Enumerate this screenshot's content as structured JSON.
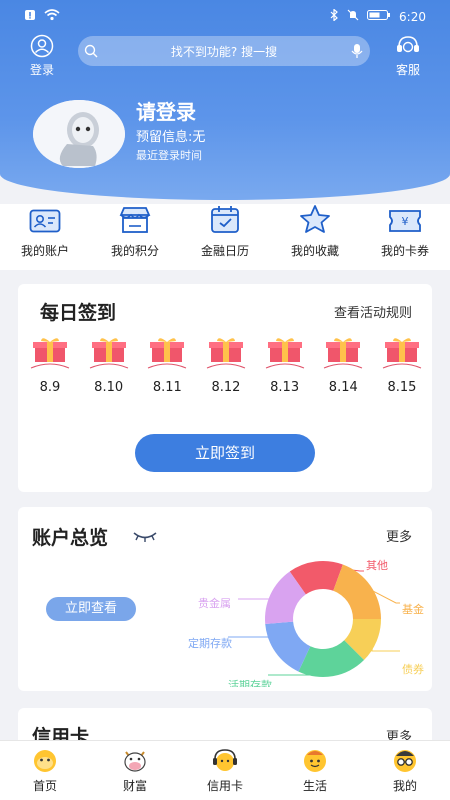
{
  "status_bar": {
    "time": "6:20"
  },
  "header": {
    "login_label": "登录",
    "service_label": "客服",
    "search_placeholder": "找不到功能? 搜一搜",
    "login_title": "请登录",
    "reserved_info": "预留信息:无",
    "last_login": "最近登录时间"
  },
  "quick_menu": [
    {
      "label": "我的账户",
      "icon": "account-card-icon"
    },
    {
      "label": "我的积分",
      "icon": "points-shop-icon"
    },
    {
      "label": "金融日历",
      "icon": "calendar-icon"
    },
    {
      "label": "我的收藏",
      "icon": "star-icon"
    },
    {
      "label": "我的卡券",
      "icon": "coupon-icon"
    }
  ],
  "checkin": {
    "title": "每日签到",
    "rules_link": "查看活动规则",
    "days": [
      "8.9",
      "8.10",
      "8.11",
      "8.12",
      "8.13",
      "8.14",
      "8.15"
    ],
    "button": "立即签到"
  },
  "overview": {
    "title": "账户总览",
    "more": "更多",
    "view_button": "立即查看",
    "segments": [
      {
        "label": "其他",
        "color": "#f25a6a"
      },
      {
        "label": "基金",
        "color": "#f8b24d"
      },
      {
        "label": "债券",
        "color": "#f7cf57"
      },
      {
        "label": "活期存款",
        "color": "#5ed39a"
      },
      {
        "label": "定期存款",
        "color": "#7fa8f3"
      },
      {
        "label": "贵金属",
        "color": "#d9a3f0"
      }
    ]
  },
  "credit": {
    "title": "信用卡",
    "more": "更多"
  },
  "bottom_nav": [
    {
      "label": "首页"
    },
    {
      "label": "财富"
    },
    {
      "label": "信用卡"
    },
    {
      "label": "生活"
    },
    {
      "label": "我的"
    }
  ]
}
